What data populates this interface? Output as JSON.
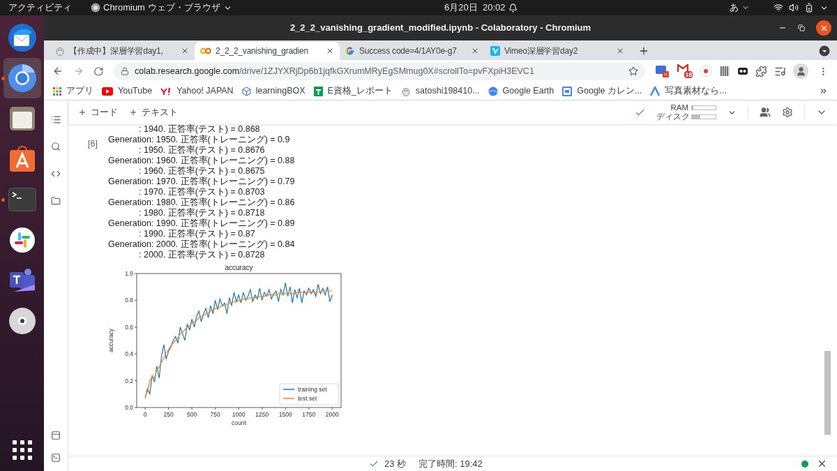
{
  "topbar": {
    "activities": "アクティビティ",
    "app": "Chromium ウェブ・ブラウザ",
    "clock": "6月20日  20:02",
    "input_method": "あ"
  },
  "dock": [
    {
      "kind": "thunderbird",
      "running": false,
      "selected": false
    },
    {
      "kind": "chromium",
      "running": true,
      "selected": true
    },
    {
      "kind": "files",
      "running": false,
      "selected": false
    },
    {
      "kind": "store",
      "running": false,
      "selected": false
    },
    {
      "kind": "terminal",
      "running": true,
      "selected": false
    },
    {
      "kind": "slack",
      "running": false,
      "selected": false
    },
    {
      "kind": "teams",
      "running": false,
      "selected": false
    },
    {
      "kind": "disc",
      "running": false,
      "selected": false
    }
  ],
  "window": {
    "title": "2_2_2_vanishing_gradient_modified.ipynb - Colaboratory - Chromium"
  },
  "tabs": [
    {
      "title": "【作成中】深層学習day1,",
      "kind": "penguin",
      "selected": false
    },
    {
      "title": "2_2_2_vanishing_gradien",
      "kind": "colab",
      "selected": true
    },
    {
      "title": "Success code=4/1AY0e-g7",
      "kind": "google",
      "selected": false
    },
    {
      "title": "Vimeo深層学習day2",
      "kind": "vimeo",
      "selected": false
    }
  ],
  "address": {
    "host": "colab.research.google.com",
    "path": "/drive/1ZJYXRjDp6b1jqfkGXrumMRyEgSMmug0X#scrollTo=pvFXpiH3EVC1"
  },
  "extensions": [
    {
      "kind": "screen"
    },
    {
      "kind": "gmail",
      "badge": "18"
    },
    {
      "kind": "record"
    },
    {
      "kind": "barcode"
    },
    {
      "kind": "toggl"
    },
    {
      "kind": "puzzle"
    },
    {
      "kind": "media"
    },
    {
      "kind": "profile"
    }
  ],
  "bookmarks": [
    {
      "label": "アプリ",
      "kind": "apps"
    },
    {
      "label": "YouTube",
      "kind": "youtube"
    },
    {
      "label": "Yahoo! JAPAN",
      "kind": "yahoo"
    },
    {
      "label": "learningBOX",
      "kind": "learningbox"
    },
    {
      "label": "E資格_レポート",
      "kind": "sheets"
    },
    {
      "label": "satoshi198410...",
      "kind": "penguin"
    },
    {
      "label": "Google Earth",
      "kind": "earth"
    },
    {
      "label": "Google カレン...",
      "kind": "calendar"
    },
    {
      "label": "写真素材なら...",
      "kind": "photo"
    }
  ],
  "toolbar": {
    "buttons": [
      "コード",
      "テキスト"
    ],
    "ram": {
      "label": "RAM",
      "level": 0.05
    },
    "disk": {
      "label": "ディスク",
      "level": 0.35
    }
  },
  "cell": {
    "number": "[6]",
    "lines": [
      {
        "kind": "test",
        "text": ": 1940. 正答率(テスト) = 0.868"
      },
      {
        "kind": "generation",
        "text": "Generation: 1950. 正答率(トレーニング) = 0.9"
      },
      {
        "kind": "test",
        "text": ": 1950. 正答率(テスト) = 0.8676"
      },
      {
        "kind": "generation",
        "text": "Generation: 1960. 正答率(トレーニング) = 0.88"
      },
      {
        "kind": "test",
        "text": ": 1960. 正答率(テスト) = 0.8675"
      },
      {
        "kind": "generation",
        "text": "Generation: 1970. 正答率(トレーニング) = 0.79"
      },
      {
        "kind": "test",
        "text": ": 1970. 正答率(テスト) = 0.8703"
      },
      {
        "kind": "generation",
        "text": "Generation: 1980. 正答率(トレーニング) = 0.86"
      },
      {
        "kind": "test",
        "text": ": 1980. 正答率(テスト) = 0.8718"
      },
      {
        "kind": "generation",
        "text": "Generation: 1990. 正答率(トレーニング) = 0.89"
      },
      {
        "kind": "test",
        "text": ": 1990. 正答率(テスト) = 0.87"
      },
      {
        "kind": "generation",
        "text": "Generation: 2000. 正答率(トレーニング) = 0.84"
      },
      {
        "kind": "test",
        "text": ": 2000. 正答率(テスト) = 0.8728"
      }
    ],
    "chart_data": {
      "type": "line",
      "title": "accuracy",
      "xlabel": "count",
      "ylabel": "accuracy",
      "xlim": [
        -90,
        2095
      ],
      "ylim": [
        0,
        1
      ],
      "xticks": [
        0,
        250,
        500,
        750,
        1000,
        1250,
        1500,
        1750,
        2000
      ],
      "yticks": [
        {
          "value": 0,
          "label": "0.0"
        },
        {
          "value": 0.2,
          "label": "0.2"
        },
        {
          "value": 0.4,
          "label": "0.4"
        },
        {
          "value": 0.6,
          "label": "0.6"
        },
        {
          "value": 0.8,
          "label": "0.8"
        },
        {
          "value": 1,
          "label": "1.0"
        }
      ],
      "legend": "lower right",
      "x": [
        0,
        25,
        50,
        75,
        100,
        125,
        150,
        175,
        200,
        225,
        250,
        275,
        300,
        325,
        350,
        375,
        400,
        425,
        450,
        475,
        500,
        525,
        550,
        575,
        600,
        625,
        650,
        675,
        700,
        725,
        750,
        775,
        800,
        825,
        850,
        875,
        900,
        925,
        950,
        975,
        1000,
        1025,
        1050,
        1075,
        1100,
        1125,
        1150,
        1175,
        1200,
        1225,
        1250,
        1275,
        1300,
        1325,
        1350,
        1375,
        1400,
        1425,
        1450,
        1475,
        1500,
        1525,
        1550,
        1575,
        1600,
        1625,
        1650,
        1675,
        1700,
        1725,
        1750,
        1775,
        1800,
        1825,
        1850,
        1875,
        1900,
        1925,
        1950,
        1975,
        2000
      ],
      "series": [
        {
          "name": "training set",
          "color": "#1f77b4",
          "values": [
            0.07,
            0.14,
            0.1,
            0.24,
            0.19,
            0.31,
            0.22,
            0.38,
            0.47,
            0.36,
            0.42,
            0.45,
            0.5,
            0.53,
            0.48,
            0.6,
            0.55,
            0.5,
            0.62,
            0.58,
            0.66,
            0.6,
            0.68,
            0.72,
            0.64,
            0.7,
            0.74,
            0.67,
            0.76,
            0.7,
            0.8,
            0.73,
            0.81,
            0.76,
            0.78,
            0.7,
            0.82,
            0.76,
            0.86,
            0.79,
            0.84,
            0.78,
            0.86,
            0.8,
            0.83,
            0.88,
            0.79,
            0.84,
            0.81,
            0.89,
            0.8,
            0.86,
            0.83,
            0.88,
            0.81,
            0.85,
            0.87,
            0.79,
            0.88,
            0.84,
            0.93,
            0.83,
            0.9,
            0.78,
            0.88,
            0.82,
            0.89,
            0.78,
            0.87,
            0.84,
            0.89,
            0.85,
            0.88,
            0.83,
            0.92,
            0.85,
            0.89,
            0.84,
            0.9,
            0.79,
            0.84
          ]
        },
        {
          "name": "test set",
          "color": "#ff7f0e",
          "values": [
            0.08,
            0.12,
            0.2,
            0.23,
            0.22,
            0.28,
            0.3,
            0.34,
            0.37,
            0.41,
            0.43,
            0.46,
            0.48,
            0.5,
            0.52,
            0.55,
            0.56,
            0.58,
            0.6,
            0.61,
            0.63,
            0.64,
            0.65,
            0.67,
            0.68,
            0.69,
            0.7,
            0.71,
            0.72,
            0.73,
            0.74,
            0.74,
            0.75,
            0.76,
            0.76,
            0.77,
            0.78,
            0.78,
            0.79,
            0.79,
            0.8,
            0.8,
            0.81,
            0.81,
            0.81,
            0.82,
            0.82,
            0.82,
            0.83,
            0.83,
            0.83,
            0.83,
            0.84,
            0.84,
            0.84,
            0.84,
            0.84,
            0.85,
            0.85,
            0.85,
            0.85,
            0.85,
            0.85,
            0.85,
            0.85,
            0.86,
            0.86,
            0.86,
            0.86,
            0.86,
            0.86,
            0.86,
            0.86,
            0.86,
            0.86,
            0.86,
            0.87,
            0.87,
            0.87,
            0.87,
            0.87
          ]
        }
      ]
    }
  },
  "status": {
    "duration": "23 秒",
    "finished": "完了時間: 19:42",
    "connected": true
  }
}
